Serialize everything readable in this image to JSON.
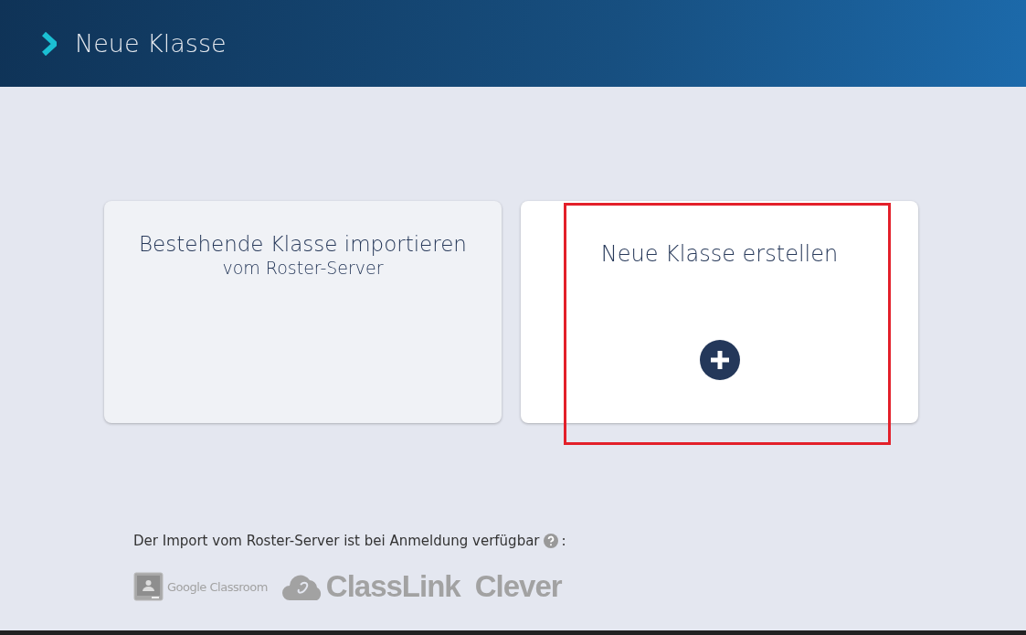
{
  "header": {
    "title": "Neue Klasse"
  },
  "cards": [
    {
      "kind": "import",
      "title": "Bestehende Klasse importieren",
      "subtitle": "vom Roster-Server",
      "highlighted": false
    },
    {
      "kind": "create",
      "title": "Neue Klasse erstellen",
      "highlighted": true
    }
  ],
  "footer": {
    "note": "Der Import vom Roster-Server ist bei Anmeldung verfügbar",
    "note_suffix": ":",
    "providers": [
      {
        "kind": "google",
        "label": "Google Classroom"
      },
      {
        "kind": "classlink",
        "label": "ClassLink"
      },
      {
        "kind": "clever",
        "label": "Clever"
      }
    ]
  }
}
